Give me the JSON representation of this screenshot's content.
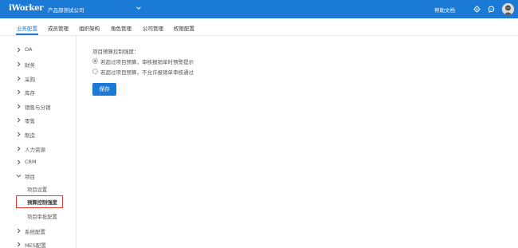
{
  "topbar": {
    "logo": "iWorker",
    "company": "产品部测试公司",
    "help": "帮助文档",
    "icons": [
      "chevron-down-icon",
      "gear-icon",
      "chat-icon",
      "avatar"
    ]
  },
  "nav": {
    "tabs": [
      {
        "label": "业务配置",
        "active": true
      },
      {
        "label": "成员管理",
        "active": false
      },
      {
        "label": "组织架构",
        "active": false
      },
      {
        "label": "角色管理",
        "active": false
      },
      {
        "label": "公司管理",
        "active": false
      },
      {
        "label": "权限配置",
        "active": false
      }
    ]
  },
  "sidebar": {
    "items": [
      {
        "label": "OA",
        "expanded": false
      },
      {
        "label": "财务",
        "expanded": false
      },
      {
        "label": "采购",
        "expanded": false
      },
      {
        "label": "库存",
        "expanded": false
      },
      {
        "label": "销售与分销",
        "expanded": false
      },
      {
        "label": "零售",
        "expanded": false
      },
      {
        "label": "制造",
        "expanded": false
      },
      {
        "label": "人力资源",
        "expanded": false
      },
      {
        "label": "CRM",
        "expanded": false
      },
      {
        "label": "项目",
        "expanded": true
      },
      {
        "label": "系统配置",
        "expanded": false
      },
      {
        "label": "MES配置",
        "expanded": false
      }
    ],
    "sub_items": [
      {
        "label": "项目设置",
        "active": false
      },
      {
        "label": "预算控制强度",
        "active": true
      },
      {
        "label": "项目审批配置",
        "active": false
      }
    ]
  },
  "main": {
    "field_label": "项目预算控制强度：",
    "options": [
      {
        "label": "若超过项目预算，审核报销单时预警提示",
        "checked": true
      },
      {
        "label": "若超过项目预算，不允许报销单审核通过",
        "checked": false
      }
    ],
    "save_label": "保存"
  },
  "colors": {
    "brand": "#1b7ad6",
    "highlight": "#e53935"
  }
}
